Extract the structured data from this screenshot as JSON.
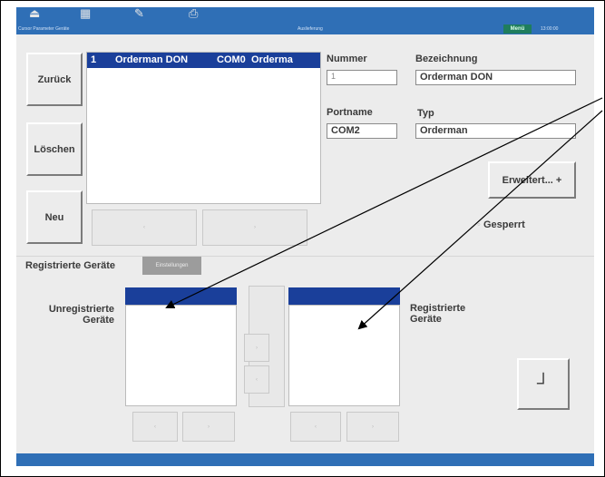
{
  "top_bar": {
    "status_left": "Cursor Parameter Geräte",
    "status_mid": "Auslieferung",
    "green_label": "Menü",
    "status_right": "13:00:00"
  },
  "left_buttons": {
    "back": "Zurück",
    "delete": "Löschen",
    "new": "Neu"
  },
  "device_list": {
    "selected_row": {
      "index": "1",
      "name": "Orderman DON",
      "port": "COM0",
      "type": "Orderma"
    }
  },
  "details": {
    "number_label": "Nummer",
    "number_value": "1",
    "designation_label": "Bezeichnung",
    "designation_value": "Orderman DON",
    "portname_label": "Portname",
    "portname_value": "COM2",
    "type_label": "Typ",
    "type_value": "Orderman",
    "extended_button": "Erweitert... +",
    "locked_label": "Gesperrt"
  },
  "tabs": {
    "active": "Registrierte Geräte",
    "inactive": "Einstellungen"
  },
  "registration": {
    "unregistered_label": "Unregistrierte Geräte",
    "registered_label": "Registrierte Geräte",
    "confirm_glyph": "┘"
  },
  "colors": {
    "top_bar": "#2f6fb6",
    "selection": "#1a3f9a",
    "panel": "#ececec",
    "menu_green": "#1f7d5d"
  }
}
